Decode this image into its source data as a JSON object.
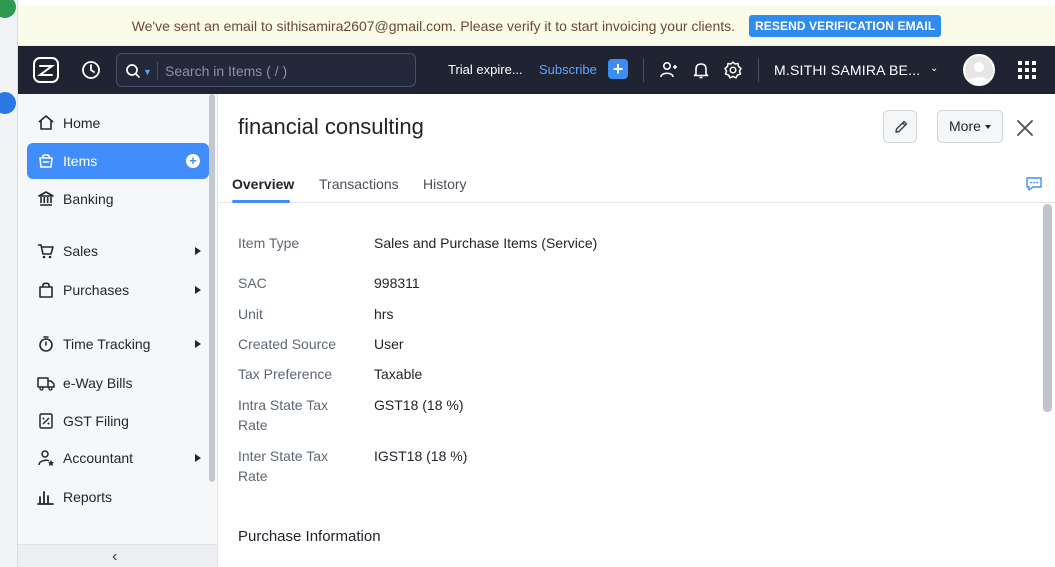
{
  "banner": {
    "message": "We've sent an email to sithisamira2607@gmail.com. Please verify it to start invoicing your clients.",
    "button": "RESEND VERIFICATION EMAIL"
  },
  "topnav": {
    "search_placeholder": "Search in Items ( / )",
    "trial": "Trial expire...",
    "subscribe": "Subscribe",
    "org_name": "M.SITHI SAMIRA BE..."
  },
  "sidebar": {
    "items": [
      {
        "label": "Home",
        "icon": "home-icon"
      },
      {
        "label": "Items",
        "icon": "items-icon"
      },
      {
        "label": "Banking",
        "icon": "bank-icon"
      },
      {
        "label": "Sales",
        "icon": "cart-icon"
      },
      {
        "label": "Purchases",
        "icon": "bag-icon"
      },
      {
        "label": "Time Tracking",
        "icon": "timer-icon"
      },
      {
        "label": "e-Way Bills",
        "icon": "truck-icon"
      },
      {
        "label": "GST Filing",
        "icon": "gst-icon"
      },
      {
        "label": "Accountant",
        "icon": "accountant-icon"
      },
      {
        "label": "Reports",
        "icon": "reports-icon"
      }
    ]
  },
  "item": {
    "title": "financial consulting",
    "more_label": "More"
  },
  "tabs": [
    "Overview",
    "Transactions",
    "History"
  ],
  "details": [
    {
      "label": "Item Type",
      "value": "Sales and Purchase Items (Service)"
    },
    {
      "label": "SAC",
      "value": "998311"
    },
    {
      "label": "Unit",
      "value": "hrs"
    },
    {
      "label": "Created Source",
      "value": "User"
    },
    {
      "label": "Tax Preference",
      "value": "Taxable"
    },
    {
      "label": "Intra State Tax Rate",
      "value": "GST18 (18 %)"
    },
    {
      "label": "Inter State Tax Rate",
      "value": "IGST18 (18 %)"
    }
  ],
  "section_title": "Purchase Information",
  "colors": {
    "accent": "#408dfb",
    "topnav_bg": "#1f2332",
    "banner_bg": "#fbfbe9"
  }
}
